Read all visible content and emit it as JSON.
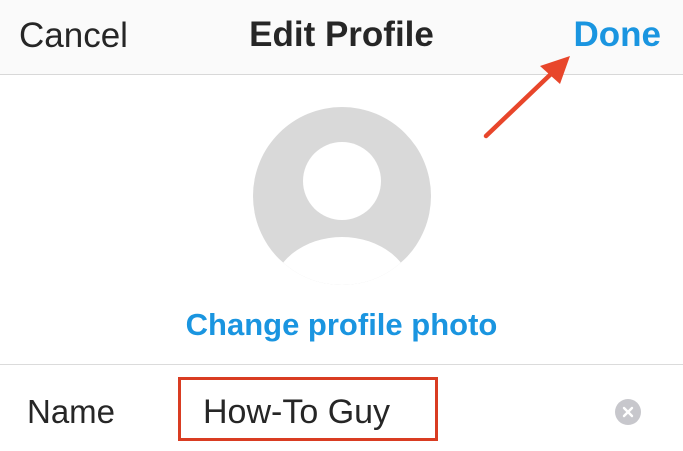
{
  "header": {
    "cancel_label": "Cancel",
    "title": "Edit Profile",
    "done_label": "Done"
  },
  "profile": {
    "avatar_icon": "default-person-icon",
    "change_photo_label": "Change profile photo"
  },
  "form": {
    "name_label": "Name",
    "name_value": "How-To Guy",
    "clear_icon": "clear-x-icon"
  },
  "annotations": {
    "arrow_color": "#e8462b",
    "highlight_box_color": "#d93c22"
  },
  "colors": {
    "accent": "#1a95e0",
    "text": "#262626",
    "avatar_bg": "#d9d9d9"
  }
}
